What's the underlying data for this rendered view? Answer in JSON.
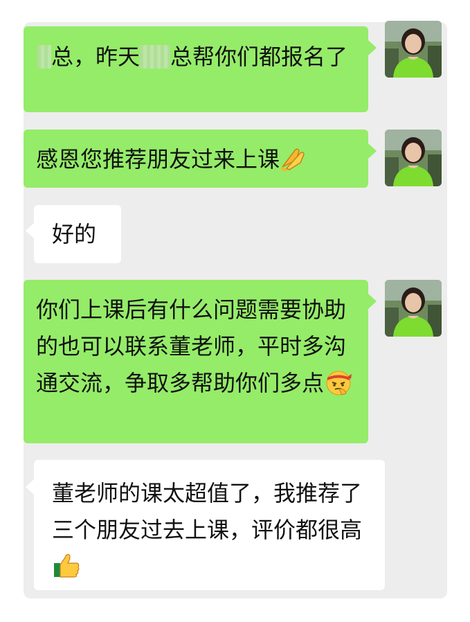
{
  "chat": {
    "messages": [
      {
        "sender": "self",
        "text_a": "总，昨天",
        "text_b": "总帮你们都报名了"
      },
      {
        "sender": "self",
        "text": "感恩您推荐朋友过来上课",
        "emoji": "folded-hands"
      },
      {
        "sender": "other",
        "text": "好的"
      },
      {
        "sender": "self",
        "text": "你们上课后有什么问题需要协助的也可以联系董老师，平时多沟通交流，争取多帮助你们多点",
        "emoji": "determined-face-with-headband"
      },
      {
        "sender": "other",
        "text": "董老师的课太超值了，我推荐了三个朋友过去上课，评价都很高",
        "emoji": "thumbs-up"
      }
    ]
  },
  "colors": {
    "outgoing_bubble": "#95ec69",
    "incoming_bubble": "#ffffff",
    "chat_background": "#ededed"
  },
  "icons": {
    "avatar": "woman-in-green-shirt-avatar"
  }
}
